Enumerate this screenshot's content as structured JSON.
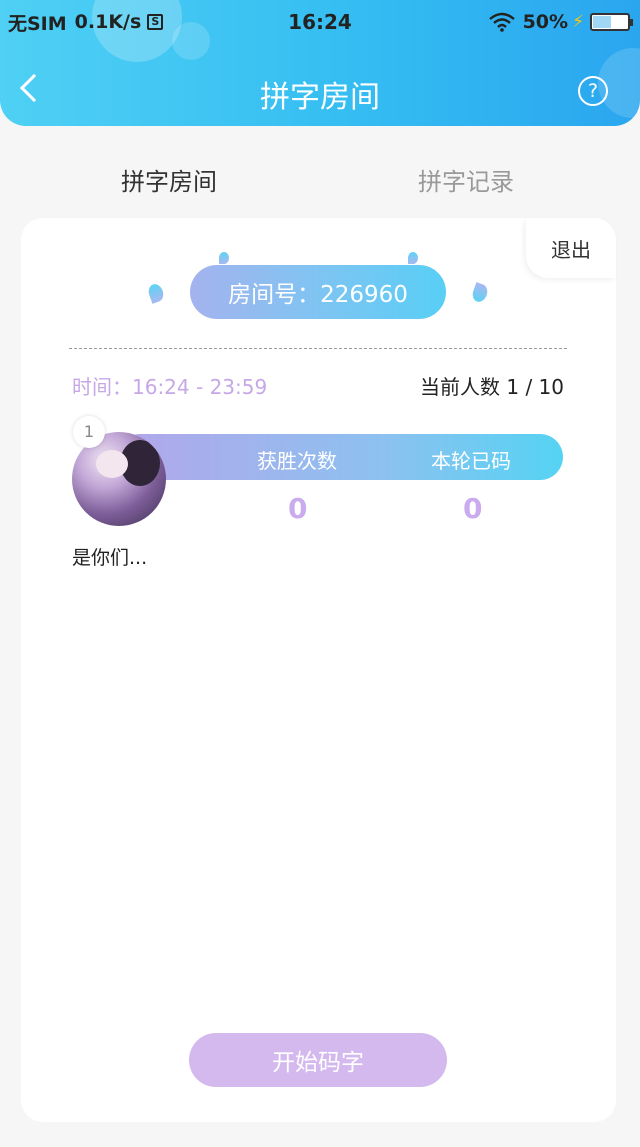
{
  "status_bar": {
    "carrier": "无SIM",
    "speed": "0.1K/s",
    "sim_icon_label": "S",
    "time": "16:24",
    "battery": "50%",
    "battery_level": 0.5,
    "icons": [
      "wifi-icon",
      "charging-bolt-icon",
      "battery-icon"
    ]
  },
  "nav": {
    "title": "拼字房间",
    "back_icon": "chevron-left-icon",
    "help_icon": "question-mark-icon",
    "help_label": "?"
  },
  "tabs": [
    {
      "label": "拼字房间",
      "active": true
    },
    {
      "label": "拼字记录",
      "active": false
    }
  ],
  "room": {
    "exit_label": "退出",
    "room_number_label": "房间号：226960",
    "time_label": "时间：16:24 - 23:59",
    "player_count_label": "当前人数 1 / 10"
  },
  "players": [
    {
      "rank": "1",
      "name": "是你们...",
      "wins_header": "获胜次数",
      "wins": "0",
      "typed_header": "本轮已码",
      "typed": "0"
    }
  ],
  "actions": {
    "start_label": "开始码字"
  },
  "colors": {
    "header_gradient": [
      "#4fd0f4",
      "#2aa6ef"
    ],
    "accent_purple": "#c9abee",
    "start_button": "#d4b9ee",
    "page_bg": "#f6f6f6"
  }
}
